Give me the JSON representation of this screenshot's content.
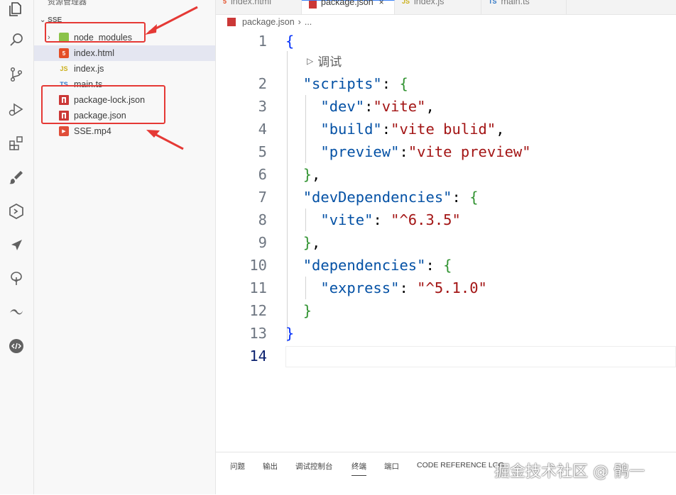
{
  "explorer": {
    "title": "资源管理器",
    "more": "···",
    "root": "SSE",
    "items": [
      {
        "label": "node_modules",
        "icon": "folder-node-icon",
        "type": "folder"
      },
      {
        "label": "index.html",
        "icon": "html-file-icon",
        "badge": "5"
      },
      {
        "label": "index.js",
        "icon": "js-file-icon",
        "badge": "JS"
      },
      {
        "label": "main.ts",
        "icon": "ts-file-icon",
        "badge": "TS"
      },
      {
        "label": "package-lock.json",
        "icon": "npm-file-icon"
      },
      {
        "label": "package.json",
        "icon": "npm-file-icon"
      },
      {
        "label": "SSE.mp4",
        "icon": "video-file-icon",
        "badge": "▶"
      }
    ],
    "selected_index": 1
  },
  "tabs": [
    {
      "label": "index.html",
      "badge": "5"
    },
    {
      "label": "package.json",
      "active": true,
      "close": "×"
    },
    {
      "label": "index.js",
      "badge": "JS"
    },
    {
      "label": "main.ts",
      "badge": "TS"
    }
  ],
  "breadcrumb": {
    "file": "package.json",
    "sep": "›",
    "rest": "..."
  },
  "editor": {
    "codelens": "调试",
    "codelens_icon": "▷",
    "line_numbers": [
      "1",
      "2",
      "3",
      "4",
      "5",
      "6",
      "7",
      "8",
      "9",
      "10",
      "11",
      "12",
      "13",
      "14"
    ],
    "active_line": 14
  },
  "panel": {
    "tabs": [
      "问题",
      "输出",
      "调试控制台",
      "终端",
      "端口",
      "CODE REFERENCE LOG"
    ],
    "active": "终端"
  },
  "watermark": "掘金技术社区 @ 鹘一",
  "colors": {
    "annotation": "#e53935",
    "accent": "#3b82f6"
  }
}
